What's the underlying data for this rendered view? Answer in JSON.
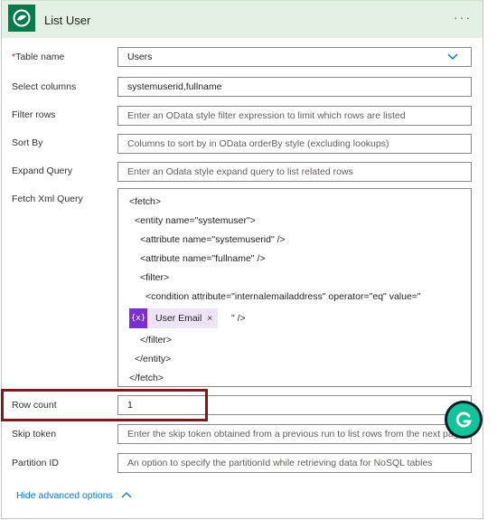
{
  "header": {
    "title": "List User",
    "more_label": "···"
  },
  "fields": {
    "table_name": {
      "required_mark": "*",
      "label": "Table name",
      "value": "Users"
    },
    "select_columns": {
      "label": "Select columns",
      "value": "systemuserid,fullname"
    },
    "filter_rows": {
      "label": "Filter rows",
      "placeholder": "Enter an OData style filter expression to limit which rows are listed"
    },
    "sort_by": {
      "label": "Sort By",
      "placeholder": "Columns to sort by in OData orderBy style (excluding lookups)"
    },
    "expand_query": {
      "label": "Expand Query",
      "placeholder": "Enter an Odata style expand query to list related rows"
    },
    "fetch_xml": {
      "label": "Fetch Xml Query",
      "lines": [
        "<fetch>",
        "<entity name=\"systemuser\">",
        "<attribute name=\"systemuserid\" />",
        "<attribute name=\"fullname\" />",
        "<filter>",
        "<condition attribute=\"internalemailaddress\" operator=\"eq\" value=\""
      ],
      "token": {
        "icon_text": "{x}",
        "label": "User Email",
        "remove": "×"
      },
      "after_token": "\" />",
      "closing_lines": [
        "</filter>",
        "</entity>",
        "</fetch>"
      ]
    },
    "row_count": {
      "label": "Row count",
      "value": "1"
    },
    "skip_token": {
      "label": "Skip token",
      "placeholder": "Enter the skip token obtained from a previous run to list rows from the next page"
    },
    "partition_id": {
      "label": "Partition ID",
      "placeholder": "An option to specify the partitionId while retrieving data for NoSQL tables"
    }
  },
  "footer": {
    "hide_advanced": "Hide advanced options"
  },
  "colors": {
    "header_bg": "#e4f0e4",
    "brand": "#0b7a4b",
    "token": "#7a2fd1",
    "highlight": "#7a1b1f",
    "link": "#0078d4",
    "grammarly": "#15c39a"
  }
}
